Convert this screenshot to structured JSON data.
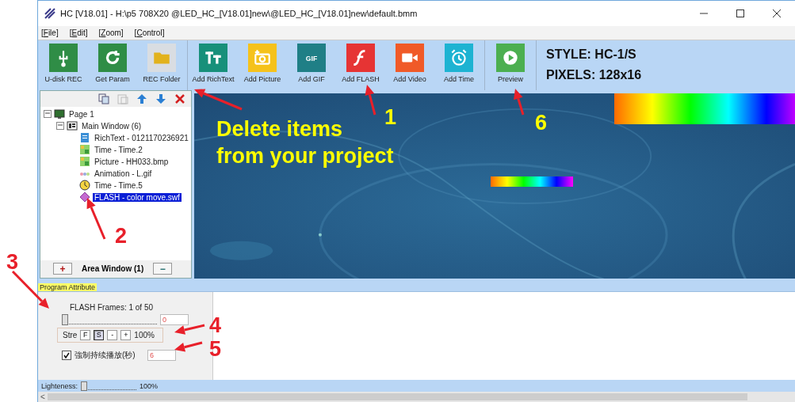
{
  "window": {
    "title": "HC [V18.01] - H:\\p5  708X20 @LED_HC_[V18.01]new\\@LED_HC_[V18.01]new\\default.bmm"
  },
  "menu": [
    "[File]",
    "[Edit]",
    "[Zoom]",
    "[Control]"
  ],
  "toolbar_groups": [
    [
      {
        "label": "U-disk REC",
        "kind": "usb"
      },
      {
        "label": "Get Param",
        "kind": "refresh"
      },
      {
        "label": "REC Folder",
        "kind": "folder"
      }
    ],
    [
      {
        "label": "Add RichText",
        "kind": "text"
      },
      {
        "label": "Add Picture"
      },
      {
        "label": "Add GIF",
        "kind": "gif",
        "icon_text": "GIF"
      },
      {
        "label": "Add FLASH",
        "kind": "flash"
      },
      {
        "label": "Add Video",
        "kind": "video"
      },
      {
        "label": "Add Time",
        "kind": "alarm"
      }
    ],
    [
      {
        "label": "Preview",
        "kind": "play"
      }
    ]
  ],
  "device_info": [
    "STYLE: HC-1/S",
    "PIXELS: 128x16"
  ],
  "tree_toolbar": [
    {
      "kind": "copy",
      "disabled": false
    },
    {
      "kind": "paste",
      "disabled": true
    },
    {
      "kind": "up",
      "disabled": false
    },
    {
      "kind": "down",
      "disabled": false
    },
    {
      "kind": "delete",
      "disabled": false
    }
  ],
  "tree": [
    {
      "label": "Page 1",
      "kind": "page",
      "expanded": true,
      "selected": false,
      "children": [
        {
          "label": "Main Window  (6)",
          "kind": "window",
          "expanded": true,
          "selected": false,
          "children": [
            {
              "label": "RichText - 0121170236921",
              "kind": "richtext",
              "selected": false
            },
            {
              "label": "Time - Time.2",
              "kind": "picture",
              "selected": false
            },
            {
              "label": "Picture - HH033.bmp",
              "kind": "picture",
              "selected": false
            },
            {
              "label": "Animation - L.gif",
              "kind": "animation",
              "selected": false
            },
            {
              "label": "Time - Time.5",
              "kind": "clock",
              "selected": false
            },
            {
              "label": "FLASH - color move.swf",
              "kind": "flash",
              "selected": true
            }
          ]
        }
      ]
    }
  ],
  "area_window": {
    "add": "+",
    "label": "Area Window (1)",
    "remove": "−"
  },
  "attribute_tab": "Program Attribute",
  "flash_frames": {
    "label": "FLASH Frames: 1 of 50",
    "level": 0,
    "value": "0"
  },
  "stretch": {
    "label": "Stre",
    "buttons": [
      {
        "label": "F",
        "selected": false
      },
      {
        "label": "S",
        "selected": true
      },
      {
        "label": "-",
        "selected": false
      },
      {
        "label": "+",
        "selected": false
      }
    ],
    "value": "100%"
  },
  "play_duration": {
    "label": "強制持续播放(秒)",
    "checked": true,
    "value": "6"
  },
  "lightness": {
    "label": "Lighteness:",
    "level": 0,
    "value": "100%"
  },
  "scrollbar": {
    "arrow": "<"
  },
  "annotations": {
    "callout": [
      "Delete items",
      "from your project"
    ],
    "numbers": [
      {
        "text": "1",
        "color": "#ffff00"
      },
      {
        "text": "6",
        "color": "#ffff00"
      },
      {
        "text": "2",
        "color": "#e8202a"
      },
      {
        "text": "3",
        "color": "#e8202a"
      },
      {
        "text": "4",
        "color": "#e8202a"
      },
      {
        "text": "5",
        "color": "#e8202a"
      }
    ]
  }
}
